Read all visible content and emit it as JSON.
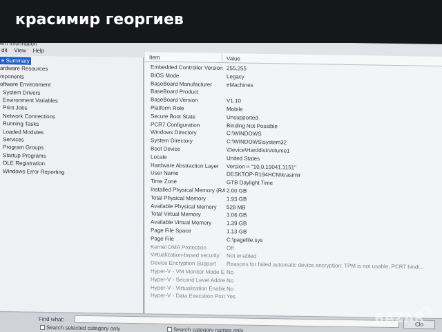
{
  "caption": "красимир георгиев",
  "window": {
    "title": "em Information",
    "menu": [
      "dit",
      "View",
      "Help"
    ]
  },
  "tree": [
    {
      "label": "e Summary",
      "selected": true,
      "level": 1
    },
    {
      "label": "ardware Resources",
      "level": 1
    },
    {
      "label": "mponents",
      "level": 1
    },
    {
      "label": "oftware Environment",
      "level": 1
    },
    {
      "label": "System Drivers",
      "level": 2
    },
    {
      "label": "Environment Variables",
      "level": 2
    },
    {
      "label": "Print Jobs",
      "level": 2
    },
    {
      "label": "Network Connections",
      "level": 2
    },
    {
      "label": "Running Tasks",
      "level": 2
    },
    {
      "label": "Loaded Modules",
      "level": 2
    },
    {
      "label": "Services",
      "level": 2
    },
    {
      "label": "Program Groups",
      "level": 2
    },
    {
      "label": "Startup Programs",
      "level": 2
    },
    {
      "label": "OLE Registration",
      "level": 2
    },
    {
      "label": "Windows Error Reporting",
      "level": 2
    }
  ],
  "list": {
    "col_item": "Item",
    "col_value": "Value",
    "rows": [
      {
        "item": "Embedded Controller Version",
        "value": "255.255"
      },
      {
        "item": "BIOS Mode",
        "value": "Legacy"
      },
      {
        "item": "BaseBoard Manufacturer",
        "value": "eMachines"
      },
      {
        "item": "BaseBoard Product",
        "value": ""
      },
      {
        "item": "BaseBoard Version",
        "value": "V1.10"
      },
      {
        "item": "Platform Role",
        "value": "Mobile"
      },
      {
        "item": "Secure Boot State",
        "value": "Unsupported"
      },
      {
        "item": "PCR7 Configuration",
        "value": "Binding Not Possible"
      },
      {
        "item": "Windows Directory",
        "value": "C:\\WINDOWS"
      },
      {
        "item": "System Directory",
        "value": "C:\\WINDOWS\\system32"
      },
      {
        "item": "Boot Device",
        "value": "\\Device\\HarddiskVolume1"
      },
      {
        "item": "Locale",
        "value": "United States"
      },
      {
        "item": "Hardware Abstraction Layer",
        "value": "Version = \"10.0.19041.1151\""
      },
      {
        "item": "User Name",
        "value": "DESKTOP-R194HCN\\krasimir"
      },
      {
        "item": "Time Zone",
        "value": "GTB Daylight Time"
      },
      {
        "item": "Installed Physical Memory (RAM)",
        "value": "2.00 GB"
      },
      {
        "item": "Total Physical Memory",
        "value": "1.93 GB"
      },
      {
        "item": "Available Physical Memory",
        "value": "528 MB"
      },
      {
        "item": "Total Virtual Memory",
        "value": "3.06 GB"
      },
      {
        "item": "Available Virtual Memory",
        "value": "1.39 GB"
      },
      {
        "item": "Page File Space",
        "value": "1.13 GB"
      },
      {
        "item": "Page File",
        "value": "C:\\pagefile.sys"
      },
      {
        "item": "Kernel DMA Protection",
        "value": "Off",
        "dim": true
      },
      {
        "item": "Virtualization-based security",
        "value": "Not enabled",
        "dim": true
      },
      {
        "item": "Device Encryption Support",
        "value": "Reasons for failed automatic device encryption: TPM is not usable, PCR7 bindi...",
        "dim": true
      },
      {
        "item": "Hyper-V - VM Monitor Mode E...",
        "value": "No",
        "dim": true
      },
      {
        "item": "Hyper-V - Second Level Addres...",
        "value": "No",
        "dim": true
      },
      {
        "item": "Hyper-V - Virtualization Enable...",
        "value": "No",
        "dim": true
      },
      {
        "item": "Hyper-V - Data Execution Prote...",
        "value": "Yes",
        "dim": true
      }
    ]
  },
  "find": {
    "label": "Find what:",
    "value": "",
    "close": "Clo",
    "check_selected": "Search selected category only",
    "check_names": "Search category names only"
  },
  "watermark": "BAZAR"
}
